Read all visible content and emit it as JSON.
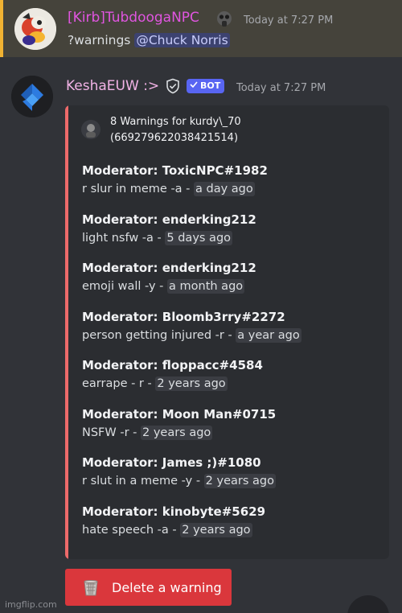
{
  "message1": {
    "username": "[Kirb]TubdoogaNPC",
    "timestamp": "Today at 7:27 PM",
    "command": "?warnings",
    "mention": "@Chuck Norris",
    "avatar_icon": "cartoon-character-avatar",
    "badge_icon": "gas-mask-icon"
  },
  "message2": {
    "username": "KeshaEUW :>",
    "timestamp": "Today at 7:27 PM",
    "bot_tag": "BOT",
    "avatar_icon": "blue-diamond-logo",
    "badge_icon": "shield-check-icon"
  },
  "embed": {
    "accent_color": "#ed6a6a",
    "author_line1": "8 Warnings for kurdy\\_70",
    "author_line2": "(669279622038421514)",
    "fields": [
      {
        "name": "Moderator: ToxicNPC#1982",
        "reason": "r slur in meme -a - ",
        "ago": "a day ago"
      },
      {
        "name": "Moderator: enderking212",
        "reason": "light nsfw -a - ",
        "ago": "5 days ago"
      },
      {
        "name": "Moderator: enderking212",
        "reason": "emoji wall -y - ",
        "ago": "a month ago"
      },
      {
        "name": "Moderator: Bloomb3rry#2272",
        "reason": "person getting injured -r - ",
        "ago": "a year ago"
      },
      {
        "name": "Moderator: floppacc#4584",
        "reason": "earrape - r - ",
        "ago": "2 years ago"
      },
      {
        "name": "Moderator: Moon Man#0715",
        "reason": "NSFW -r - ",
        "ago": "2 years ago"
      },
      {
        "name": "Moderator: James ;)#1080",
        "reason": "r slut in a meme -y - ",
        "ago": "2 years ago"
      },
      {
        "name": "Moderator: kinobyte#5629",
        "reason": "hate speech -a - ",
        "ago": "2 years ago"
      }
    ]
  },
  "button": {
    "label": "Delete a warning",
    "icon": "wastebasket-icon",
    "color": "#da373c"
  },
  "watermark": "imgflip.com"
}
